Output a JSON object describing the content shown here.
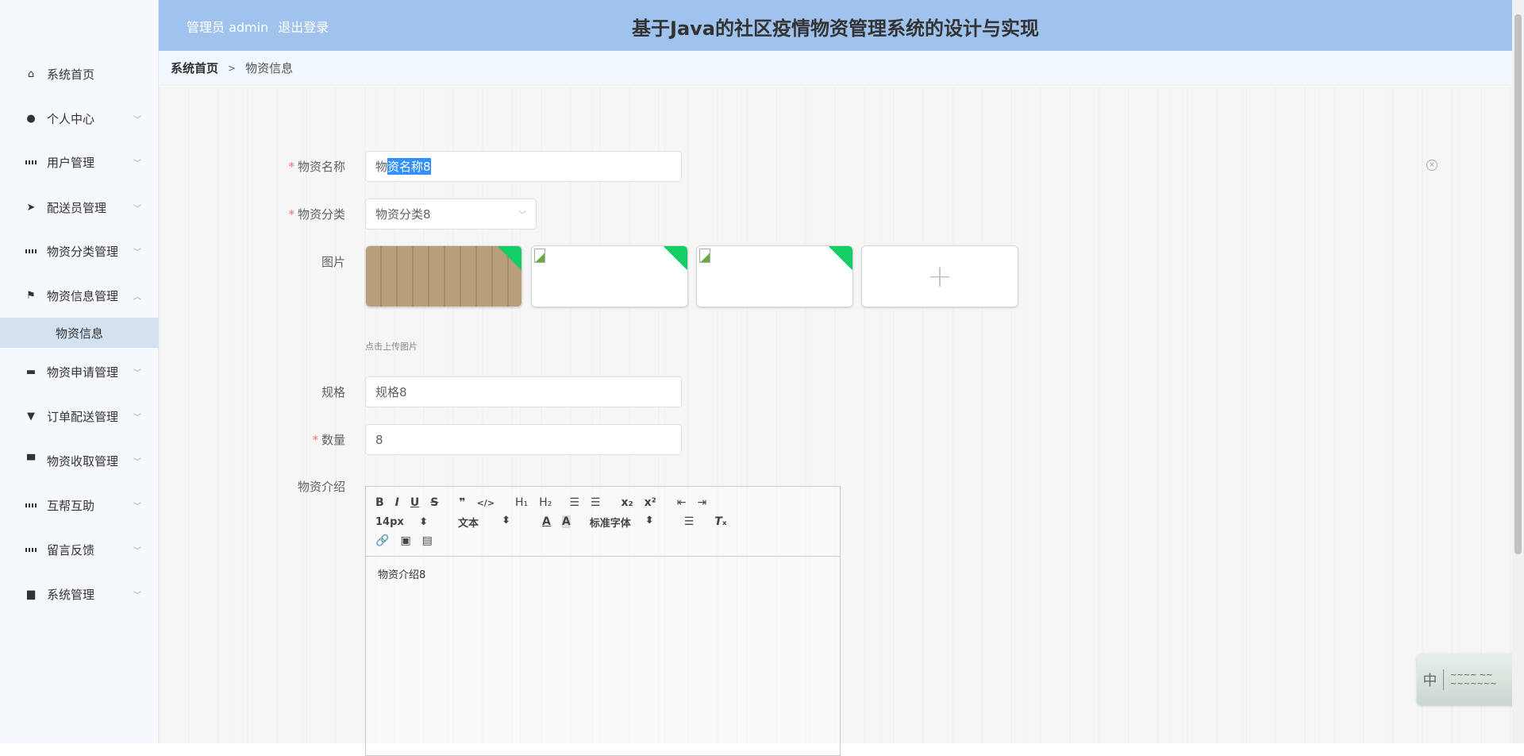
{
  "header": {
    "user": "管理员 admin",
    "logout": "退出登录",
    "title": "基于Java的社区疫情物资管理系统的设计与实现"
  },
  "breadcrumb": {
    "home": "系统首页",
    "separator": ">",
    "current": "物资信息"
  },
  "sidebar": {
    "items": [
      {
        "label": "系统首页",
        "icon": "home-icon"
      },
      {
        "label": "个人中心",
        "icon": "user-icon"
      },
      {
        "label": "用户管理",
        "icon": "grid-icon"
      },
      {
        "label": "配送员管理",
        "icon": "send-icon"
      },
      {
        "label": "物资分类管理",
        "icon": "grid-icon"
      },
      {
        "label": "物资信息管理",
        "icon": "flag-icon"
      },
      {
        "label": "物资申请管理",
        "icon": "briefcase-icon"
      },
      {
        "label": "订单配送管理",
        "icon": "brush-icon"
      },
      {
        "label": "物资收取管理",
        "icon": "shop-icon"
      },
      {
        "label": "互帮互助",
        "icon": "grid-icon"
      },
      {
        "label": "留言反馈",
        "icon": "grid-icon"
      },
      {
        "label": "系统管理",
        "icon": "message-icon"
      }
    ],
    "sub_item": "物资信息"
  },
  "form": {
    "name_label": "物资名称",
    "name_prefix": "物",
    "name_selected": "资名称8",
    "category_label": "物资分类",
    "category_value": "物资分类8",
    "image_label": "图片",
    "upload_hint": "点击上传图片",
    "spec_label": "规格",
    "spec_value": "规格8",
    "qty_label": "数量",
    "qty_value": "8",
    "intro_label": "物资介绍",
    "editor": {
      "size": "14px",
      "header": "文本",
      "font": "标准字体",
      "content": "物资介绍8"
    }
  },
  "ime": {
    "mode": "中"
  }
}
